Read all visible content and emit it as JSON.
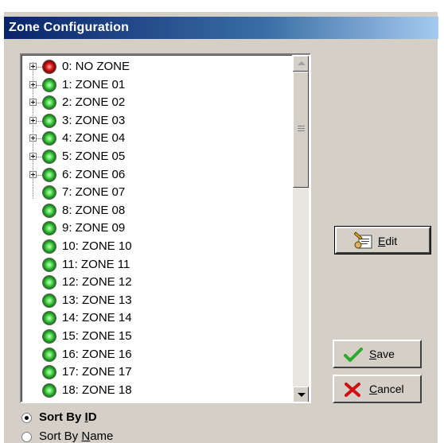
{
  "window": {
    "title": "Zone Configuration"
  },
  "zones": [
    {
      "label": "0: NO ZONE",
      "status": "red",
      "expandable": true
    },
    {
      "label": "1: ZONE 01",
      "status": "green",
      "expandable": true
    },
    {
      "label": "2: ZONE 02",
      "status": "green",
      "expandable": true
    },
    {
      "label": "3: ZONE 03",
      "status": "green",
      "expandable": true
    },
    {
      "label": "4: ZONE 04",
      "status": "green",
      "expandable": true
    },
    {
      "label": "5: ZONE 05",
      "status": "green",
      "expandable": true
    },
    {
      "label": "6: ZONE 06",
      "status": "green",
      "expandable": true
    },
    {
      "label": "7: ZONE 07",
      "status": "green",
      "expandable": false
    },
    {
      "label": "8: ZONE 08",
      "status": "green",
      "expandable": false
    },
    {
      "label": "9: ZONE 09",
      "status": "green",
      "expandable": false
    },
    {
      "label": "10: ZONE 10",
      "status": "green",
      "expandable": false
    },
    {
      "label": "11: ZONE 11",
      "status": "green",
      "expandable": false
    },
    {
      "label": "12: ZONE 12",
      "status": "green",
      "expandable": false
    },
    {
      "label": "13: ZONE 13",
      "status": "green",
      "expandable": false
    },
    {
      "label": "14: ZONE 14",
      "status": "green",
      "expandable": false
    },
    {
      "label": "15: ZONE 15",
      "status": "green",
      "expandable": false
    },
    {
      "label": "16: ZONE 16",
      "status": "green",
      "expandable": false
    },
    {
      "label": "17: ZONE 17",
      "status": "green",
      "expandable": false
    },
    {
      "label": "18: ZONE 18",
      "status": "green",
      "expandable": false
    }
  ],
  "buttons": {
    "edit": {
      "mnemonic": "E",
      "rest": "dit",
      "icon": "edit-icon"
    },
    "save": {
      "mnemonic": "S",
      "rest": "ave",
      "icon": "checkmark-icon"
    },
    "cancel": {
      "mnemonic": "C",
      "rest": "ancel",
      "icon": "x-icon"
    }
  },
  "sort": {
    "by_id": {
      "prefix": "Sort By ",
      "mnemonic": "I",
      "rest": "D",
      "selected": true
    },
    "by_name": {
      "prefix": "Sort By ",
      "mnemonic": "N",
      "rest": "ame",
      "selected": false
    }
  },
  "colors": {
    "titlebar": "#0a246a",
    "face": "#d4d0c8",
    "ok_green": "#2ea82e",
    "cancel_red": "#d01010"
  }
}
